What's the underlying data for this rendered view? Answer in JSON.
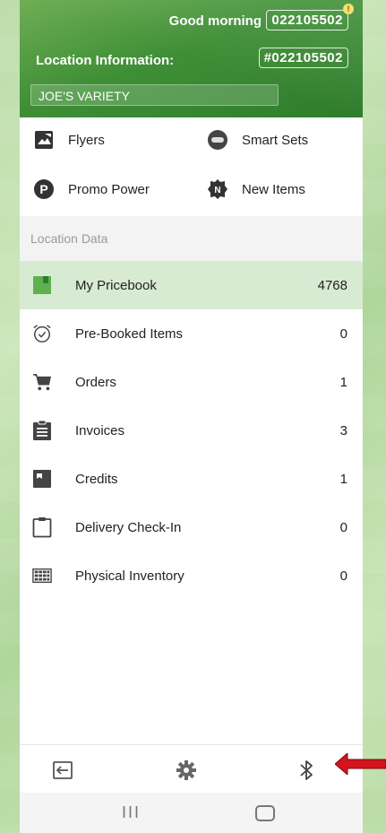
{
  "header": {
    "greeting": "Good morning",
    "account_code": "022105502",
    "location_label": "Location Information:",
    "location_code": "#022105502",
    "store_name": "JOE'S VARIETY",
    "notification_badge": "!"
  },
  "quick_links": [
    {
      "label": "Flyers",
      "icon": "flyers-icon"
    },
    {
      "label": "Smart Sets",
      "icon": "smart-sets-icon"
    },
    {
      "label": "Promo Power",
      "icon": "promo-power-icon"
    },
    {
      "label": "New Items",
      "icon": "new-items-icon"
    }
  ],
  "section_title": "Location Data",
  "menu": [
    {
      "label": "My Pricebook",
      "count": "4768",
      "icon": "pricebook-icon",
      "active": true
    },
    {
      "label": "Pre-Booked Items",
      "count": "0",
      "icon": "alarm-clock-icon"
    },
    {
      "label": "Orders",
      "count": "1",
      "icon": "cart-icon"
    },
    {
      "label": "Invoices",
      "count": "3",
      "icon": "invoice-icon"
    },
    {
      "label": "Credits",
      "count": "1",
      "icon": "credits-icon"
    },
    {
      "label": "Delivery Check-In",
      "count": "0",
      "icon": "clipboard-icon"
    },
    {
      "label": "Physical Inventory",
      "count": "0",
      "icon": "inventory-icon"
    }
  ],
  "bottom_bar": [
    {
      "icon": "logout-icon"
    },
    {
      "icon": "gear-icon"
    },
    {
      "icon": "bluetooth-icon"
    }
  ],
  "android_nav": {
    "recent": "III"
  },
  "colors": {
    "header_green": "#3f8f36",
    "active_row": "#d7ebd2",
    "arrow_red": "#d4141c"
  }
}
